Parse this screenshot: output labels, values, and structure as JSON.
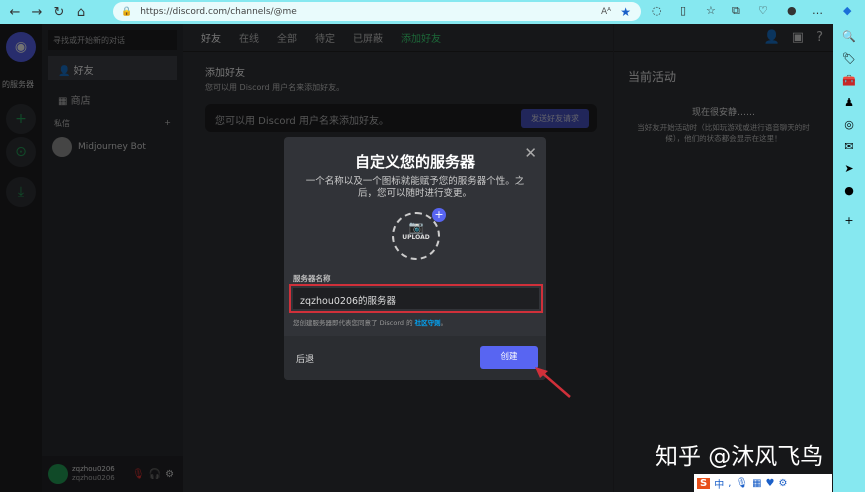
{
  "browser": {
    "url": "https://discord.com/channels/@me",
    "read_aloud": "Aᴬ"
  },
  "discord": {
    "search_placeholder": "寻找或开始新的对话",
    "server_label": "的服务器",
    "nav": [
      {
        "label": "好友"
      },
      {
        "label": "商店"
      }
    ],
    "dm_header": "私信",
    "dm_add": "+",
    "dms": [
      {
        "name": "Midjourney Bot"
      }
    ],
    "user": {
      "name": "zqzhou0206",
      "tag": "zqzhou0206"
    },
    "tabs": {
      "friends": "好友",
      "online": "在线",
      "all": "全部",
      "pending": "待定",
      "blocked": "已屏蔽",
      "add": "添加好友"
    },
    "add_friend": {
      "title": "添加好友",
      "desc": "您可以用 Discord 用户名来添加好友。",
      "placeholder": "您可以用 Discord 用户名来添加好友。",
      "button": "发送好友请求"
    },
    "activity": {
      "title": "当前活动",
      "quiet": "现在很安静……",
      "desc": "当好友开始活动时（比如玩游戏或进行语音聊天的时候），他们的状态都会显示在这里！"
    }
  },
  "modal": {
    "title": "自定义您的服务器",
    "subtitle": "一个名称以及一个图标就能赋予您的服务器个性。之后，您可以随时进行变更。",
    "upload": "UPLOAD",
    "name_label": "服务器名称",
    "name_value": "zqzhou0206的服务器",
    "terms_prefix": "您创建服务器即代表您同意了 Discord 的 ",
    "terms_link": "社区守则",
    "terms_suffix": "。",
    "back": "后退",
    "create": "创建"
  },
  "watermark": "知乎 @沐风飞鸟",
  "ime": "中",
  "colors": {
    "accent": "#5865f2",
    "green": "#23a55a",
    "highlight": "#d0303a"
  }
}
